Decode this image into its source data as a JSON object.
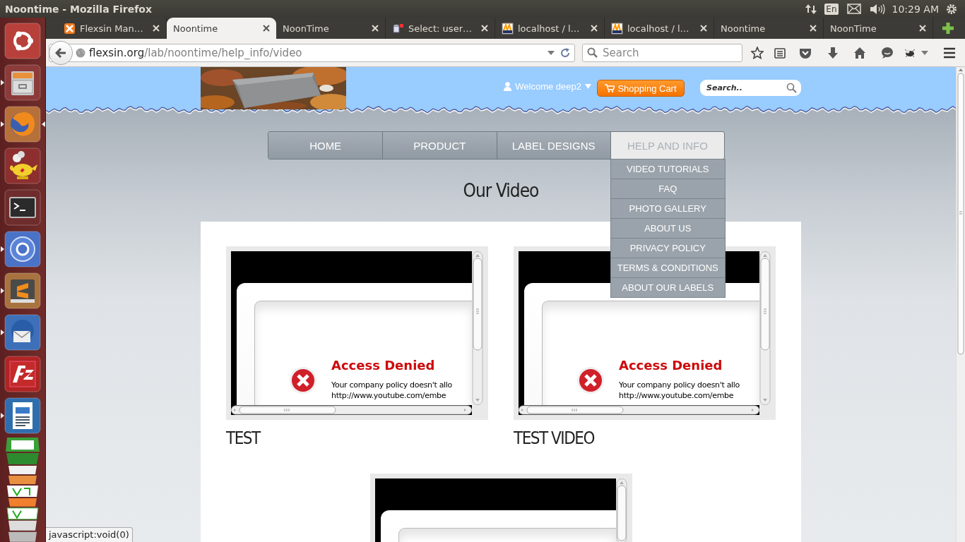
{
  "window": {
    "title": "Noontime - Mozilla Firefox"
  },
  "system_tray": {
    "keyboard_layout": "En",
    "clock": "10:29 AM"
  },
  "launcher": {
    "items": [
      {
        "kind": "ubuntu",
        "running": false,
        "selected": false
      },
      {
        "kind": "files",
        "running": true,
        "selected": false
      },
      {
        "kind": "firefox",
        "running": true,
        "selected": true
      },
      {
        "kind": "teapot",
        "running": false,
        "selected": false
      },
      {
        "kind": "terminal",
        "running": false,
        "selected": false
      },
      {
        "kind": "chromium",
        "running": true,
        "selected": false
      },
      {
        "kind": "sublime",
        "running": true,
        "selected": false
      },
      {
        "kind": "thunderbird",
        "running": true,
        "selected": false
      },
      {
        "kind": "filezilla",
        "running": false,
        "selected": false
      },
      {
        "kind": "writer",
        "running": true,
        "selected": false
      }
    ]
  },
  "tabs": [
    {
      "kind": "xampp",
      "title": "Flexsin Man…",
      "selected": false
    },
    {
      "kind": "plain",
      "title": "Noontime",
      "selected": true
    },
    {
      "kind": "plain",
      "title": "NoonTime",
      "selected": false
    },
    {
      "kind": "database",
      "title": "Select: user…",
      "selected": false
    },
    {
      "kind": "pma",
      "title": "localhost / l…",
      "selected": false
    },
    {
      "kind": "pma",
      "title": "localhost / l…",
      "selected": false
    },
    {
      "kind": "plain",
      "title": "Noontime",
      "selected": false
    },
    {
      "kind": "plain",
      "title": "NoonTime",
      "selected": false
    }
  ],
  "address_bar": {
    "host": "flexsin.org",
    "path": "/lab/noontime/help_info/video"
  },
  "search_field": {
    "placeholder": "Search"
  },
  "page": {
    "welcome": "Welcome deep2",
    "cart_button": "Shopping Cart",
    "search": {
      "placeholder": "Search.."
    },
    "menu": [
      {
        "label": "HOME",
        "selected": false
      },
      {
        "label": "PRODUCT",
        "selected": false
      },
      {
        "label": "LABEL DESIGNS",
        "selected": false
      },
      {
        "label": "HELP AND INFO",
        "selected": true,
        "submenu": [
          "VIDEO TUTORIALS",
          "FAQ",
          "PHOTO GALLERY",
          "ABOUT US",
          "PRIVACY POLICY",
          "TERMS & CONDITIONS",
          "ABOUT OUR LABELS"
        ]
      }
    ],
    "heading": "Our Video",
    "videos": [
      {
        "kind": "embed",
        "title": "TEST",
        "message": {
          "title": "Access Denied",
          "lines": [
            "Your company policy doesn't allo",
            "http://www.youtube.com/embe"
          ]
        }
      },
      {
        "kind": "embed",
        "title": "TEST VIDEO",
        "message": {
          "title": "Access Denied",
          "lines": [
            "Your company policy doesn't allo",
            "http://www.youtube.com/embe"
          ]
        }
      },
      {
        "kind": "embed"
      }
    ]
  },
  "status_text": "javascript:void(0)"
}
